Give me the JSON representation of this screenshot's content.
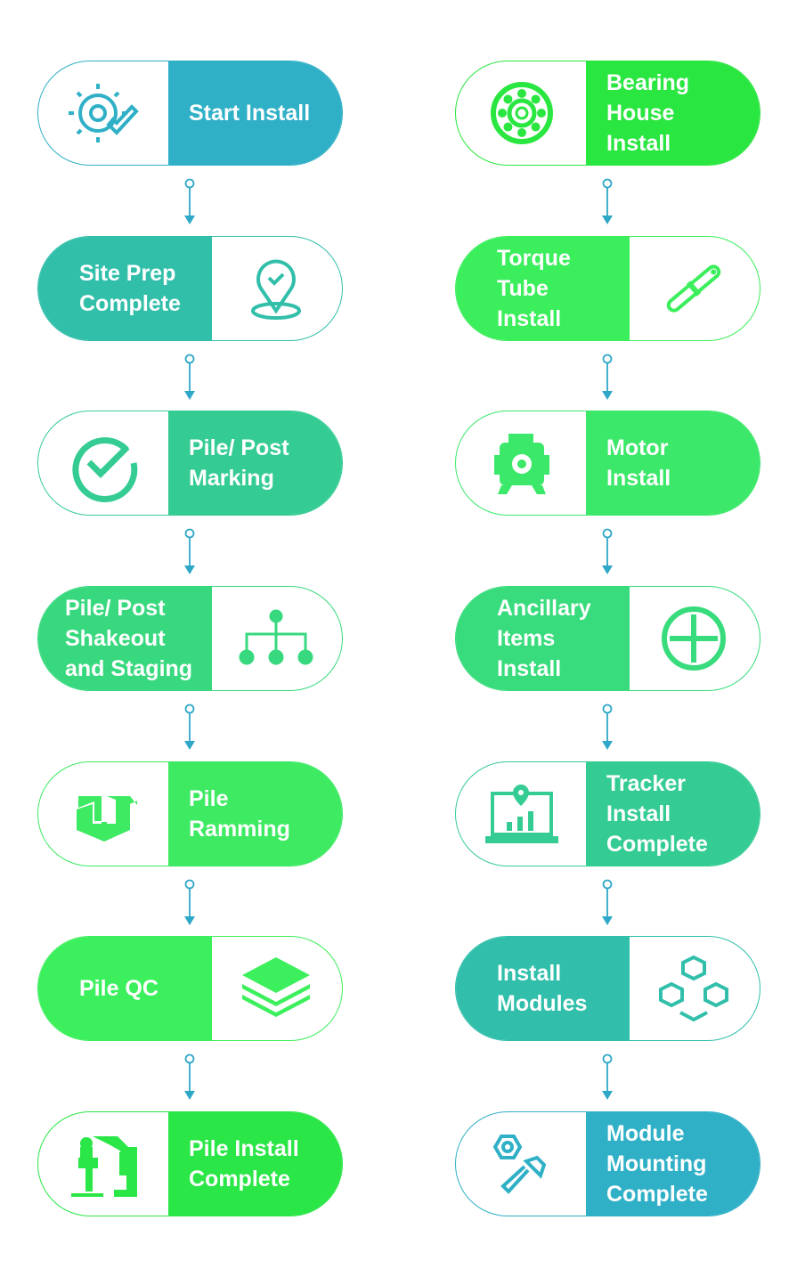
{
  "left_column": [
    {
      "label": "Start Install",
      "icon": "gear-check-icon",
      "color": "#30b0c7"
    },
    {
      "label": "Site Prep\nComplete",
      "icon": "location-check-icon",
      "color": "#32bfaa"
    },
    {
      "label": "Pile/ Post\nMarking",
      "icon": "check-circle-icon",
      "color": "#35cc94"
    },
    {
      "label": "Pile/ Post\nShakeout\nand Staging",
      "icon": "hierarchy-icon",
      "color": "#38d97e"
    },
    {
      "label": "Pile\nRamming",
      "icon": "pile-block-icon",
      "color": "#3dea62"
    },
    {
      "label": "Pile QC",
      "icon": "layers-icon",
      "color": "#3cef5c"
    },
    {
      "label": "Pile Install\nComplete",
      "icon": "pile-driver-icon",
      "color": "#2ae646"
    }
  ],
  "right_column": [
    {
      "label": "Bearing\nHouse\nInstall",
      "icon": "bearing-icon",
      "color": "#2ae640"
    },
    {
      "label": "Torque\nTube\nInstall",
      "icon": "wrench-icon",
      "color": "#3bee5b"
    },
    {
      "label": "Motor\nInstall",
      "icon": "motor-icon",
      "color": "#3ce86a"
    },
    {
      "label": "Ancillary\nItems\nInstall",
      "icon": "plus-circle-icon",
      "color": "#38dc7c"
    },
    {
      "label": "Tracker\nInstall\nComplete",
      "icon": "laptop-chart-icon",
      "color": "#35cc94"
    },
    {
      "label": "Install\nModules",
      "icon": "cubes-icon",
      "color": "#31bfab"
    },
    {
      "label": "Module\nMounting\nComplete",
      "icon": "nut-bolt-icon",
      "color": "#30b0c7"
    }
  ],
  "connector_color": "#2fa8c8"
}
